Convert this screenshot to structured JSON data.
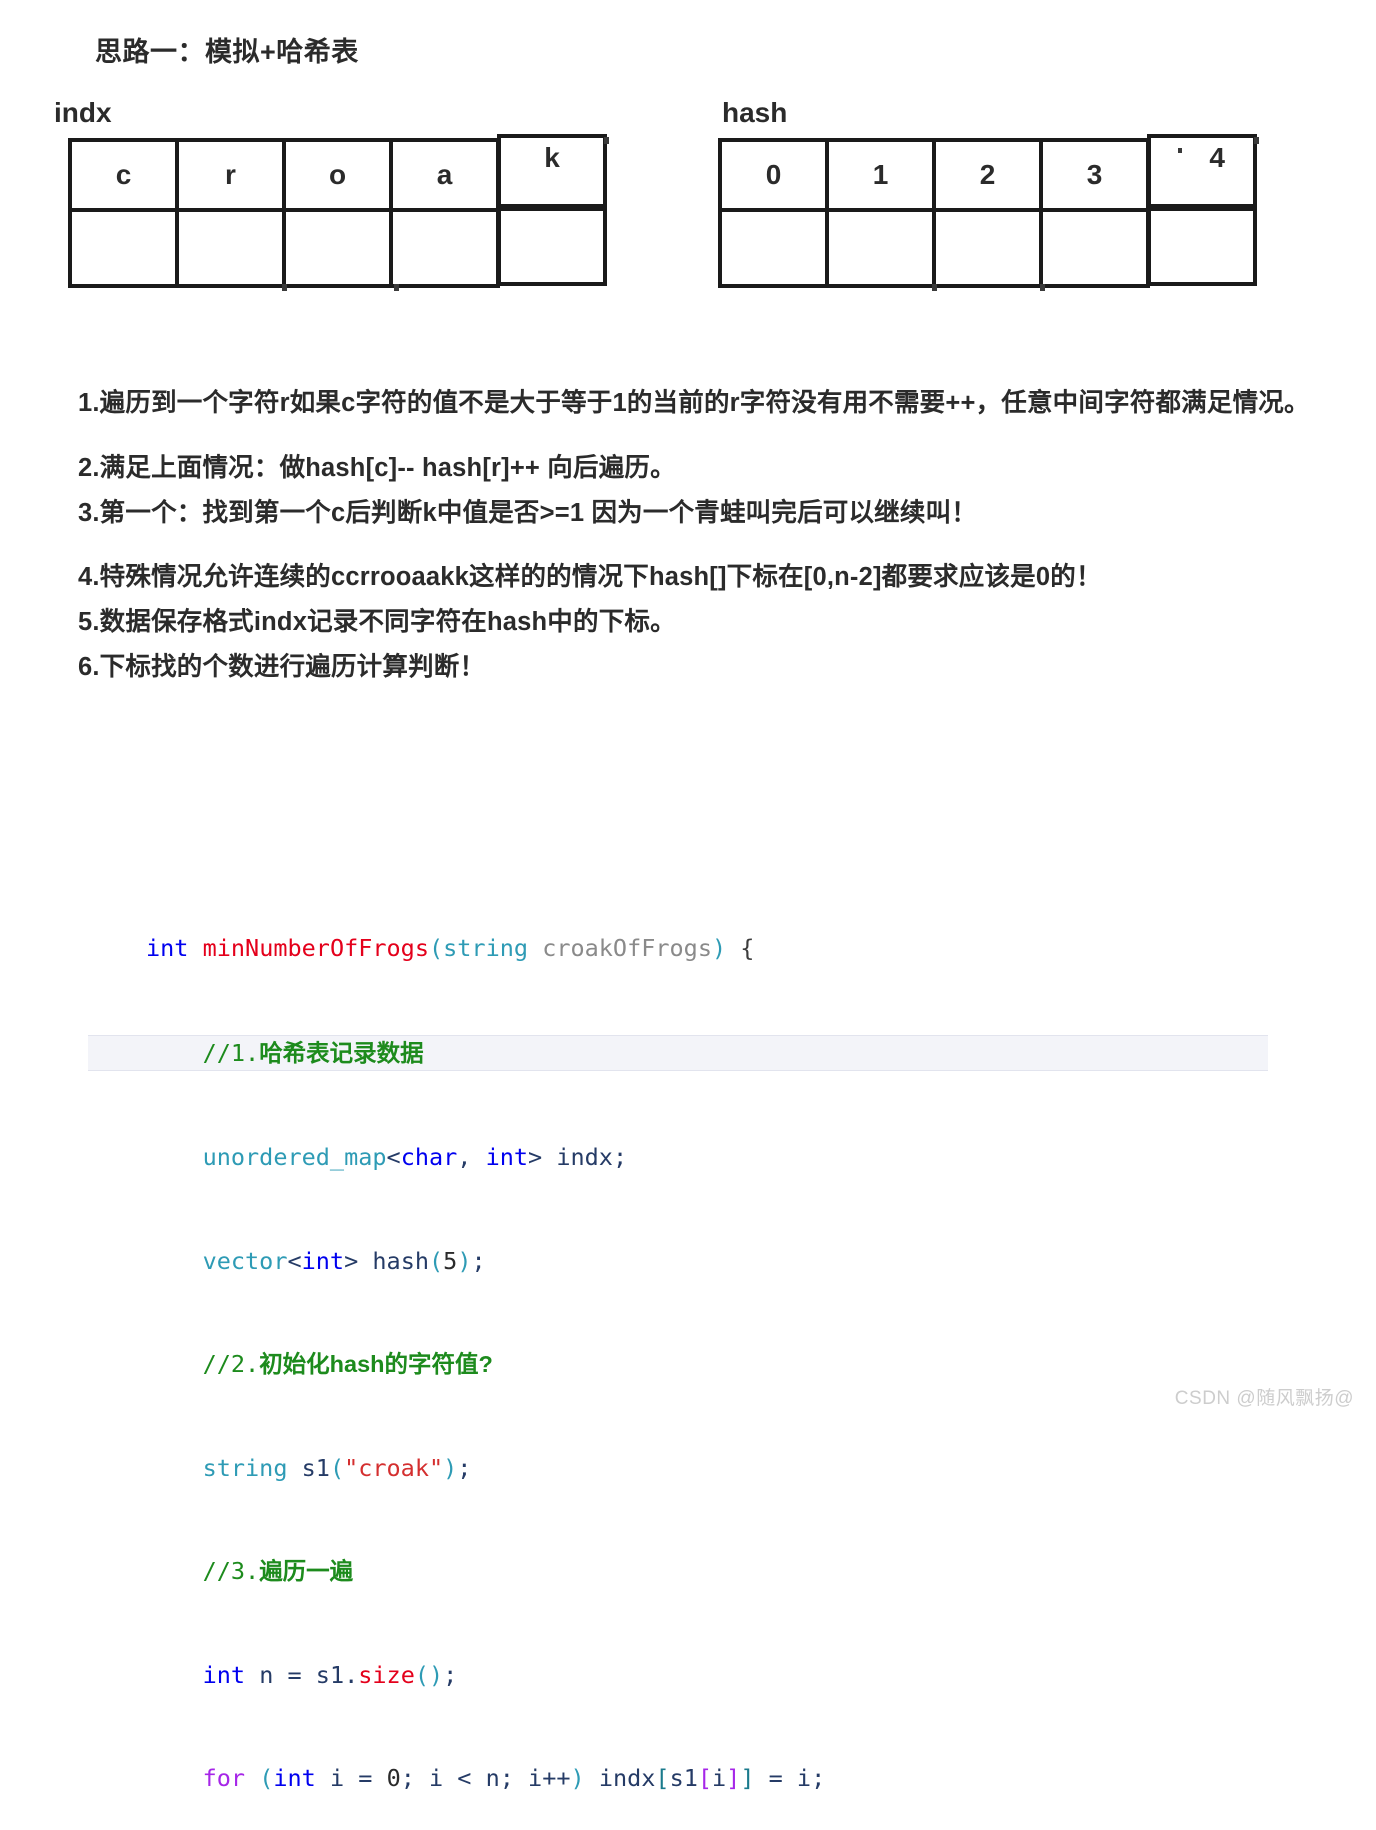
{
  "heading": "思路一：模拟+哈希表",
  "tables": {
    "indx": {
      "label": "indx",
      "header": [
        "c",
        "r",
        "o",
        "a",
        "k"
      ],
      "values": [
        "",
        "",
        "",
        "",
        ""
      ]
    },
    "hash": {
      "label": "hash",
      "header": [
        "0",
        "1",
        "2",
        "3",
        "4"
      ],
      "values": [
        "",
        "",
        "",
        "",
        ""
      ]
    }
  },
  "notes": [
    "1.遍历到一个字符r如果c字符的值不是大于等于1的当前的r字符没有用不需要++，任意中间字符都满足情况。",
    "2.满足上面情况：做hash[c]-- hash[r]++ 向后遍历。",
    "3.第一个：找到第一个c后判断k中值是否>=1 因为一个青蛙叫完后可以继续叫！",
    "4.特殊情况允许连续的ccrrooaakk这样的的情况下hash[]下标在[0,n-2]都要求应该是0的！",
    "5.数据保存格式indx记录不同字符在hash中的下标。",
    "6.下标找的个数进行遍历计算判断！"
  ],
  "code": {
    "language": "cpp",
    "lines": [
      "int minNumberOfFrogs(string croakOfFrogs) {",
      "    //1.哈希表记录数据",
      "    unordered_map<char, int> indx;",
      "    vector<int> hash(5);",
      "    //2.初始化hash的字符值?",
      "    string s1(\"croak\");",
      "    //3.遍历一遍",
      "    int n = s1.size();",
      "    for (int i = 0; i < n; i++) indx[s1[i]] = i;"
    ],
    "highlighted_line_index": 1
  },
  "watermark": "CSDN @随风飘扬@",
  "colors": {
    "keyword": "#0000ef",
    "control": "#a626e8",
    "type": "#2e9bb5",
    "function": "#e4001b",
    "comment": "#1d8b1d",
    "string": "#d42f2f",
    "parameter": "#8a8a8a",
    "identifier": "#253b66",
    "table_border": "#1a1a1a",
    "text": "#2b2b2b",
    "highlight_row": "#f3f4f9",
    "watermark": "#cdcdcd"
  }
}
